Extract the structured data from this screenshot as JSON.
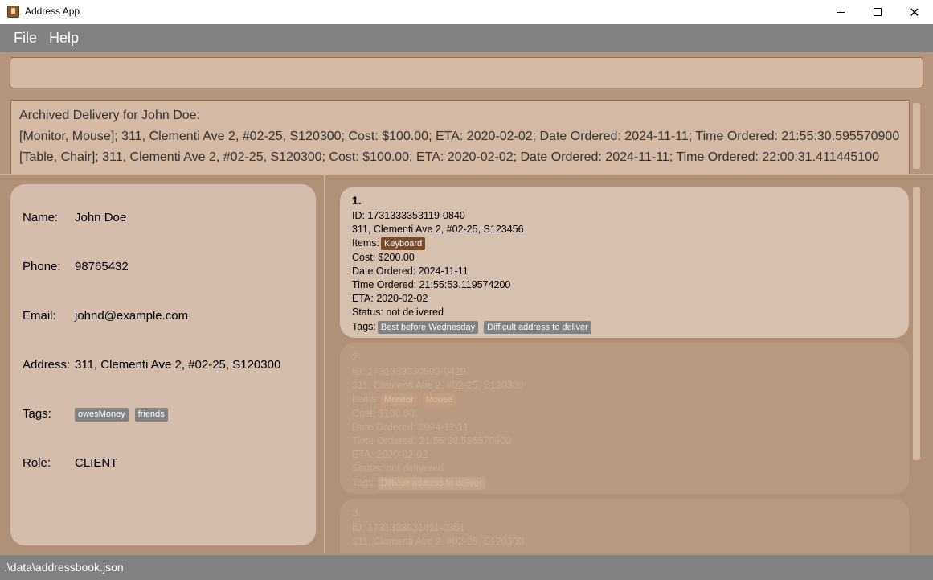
{
  "window": {
    "title": "Address App",
    "minimize_glyph": "",
    "maximize_glyph": "",
    "close_glyph": "✕"
  },
  "menu": {
    "file": "File",
    "help": "Help"
  },
  "command_box": {
    "value": "",
    "placeholder": ""
  },
  "result": {
    "lines": [
      "Archived Delivery for John Doe:",
      "[Monitor, Mouse]; 311, Clementi Ave 2, #02-25, S120300; Cost: $100.00; ETA: 2020-02-02; Date Ordered: 2024-11-11; Time Ordered: 21:55:30.595570900",
      "[Table, Chair]; 311, Clementi Ave 2, #02-25, S120300; Cost: $100.00; ETA: 2020-02-02; Date Ordered: 2024-11-11; Time Ordered: 22:00:31.411445100"
    ]
  },
  "person": {
    "name_label": "Name:",
    "name": "John Doe",
    "phone_label": "Phone:",
    "phone": "98765432",
    "email_label": "Email:",
    "email": "johnd@example.com",
    "address_label": "Address:",
    "address": "311, Clementi Ave 2, #02-25, S120300",
    "tags_label": "Tags:",
    "tags": [
      "owesMoney",
      "friends"
    ],
    "role_label": "Role:",
    "role": "CLIENT"
  },
  "deliveries": [
    {
      "index": "1.",
      "id": "ID: 1731333353119-0840",
      "address": "311, Clementi Ave 2, #02-25, S123456",
      "items_label": "Items:",
      "items": [
        "Keyboard"
      ],
      "cost": "Cost: $200.00",
      "date_ordered": "Date Ordered: 2024-11-11",
      "time_ordered": "Time Ordered: 21:55:53.119574200",
      "eta": "ETA: 2020-02-02",
      "status": "Status: not delivered",
      "tags_label": "Tags:",
      "tags": [
        "Best before Wednesday",
        "Difficult address to deliver"
      ]
    },
    {
      "index": "2.",
      "id": "ID: 1731333330593-0429",
      "address": "311, Clementi Ave 2, #02-25, S120300",
      "items_label": "Items:",
      "items": [
        "Monitor",
        "Mouse"
      ],
      "cost": "Cost: $100.00",
      "date_ordered": "Date Ordered: 2024-11-11",
      "time_ordered": "Time Ordered: 21:55:30.595570900",
      "eta": "ETA: 2020-02-02",
      "status": "Status: not delivered",
      "tags_label": "Tags:",
      "tags": [
        "Difficult address to deliver"
      ]
    },
    {
      "index": "3.",
      "id": "ID: 1731333631411-0351",
      "address": "311, Clementi Ave 2, #02-25, S120300"
    }
  ],
  "status_bar": {
    "path": ".\\data\\addressbook.json"
  },
  "colors": {
    "background": "#b09177",
    "menubar": "#818181",
    "card": "#d4bdac",
    "item_chip": "#7a4a2a",
    "tag_chip": "#818181"
  }
}
